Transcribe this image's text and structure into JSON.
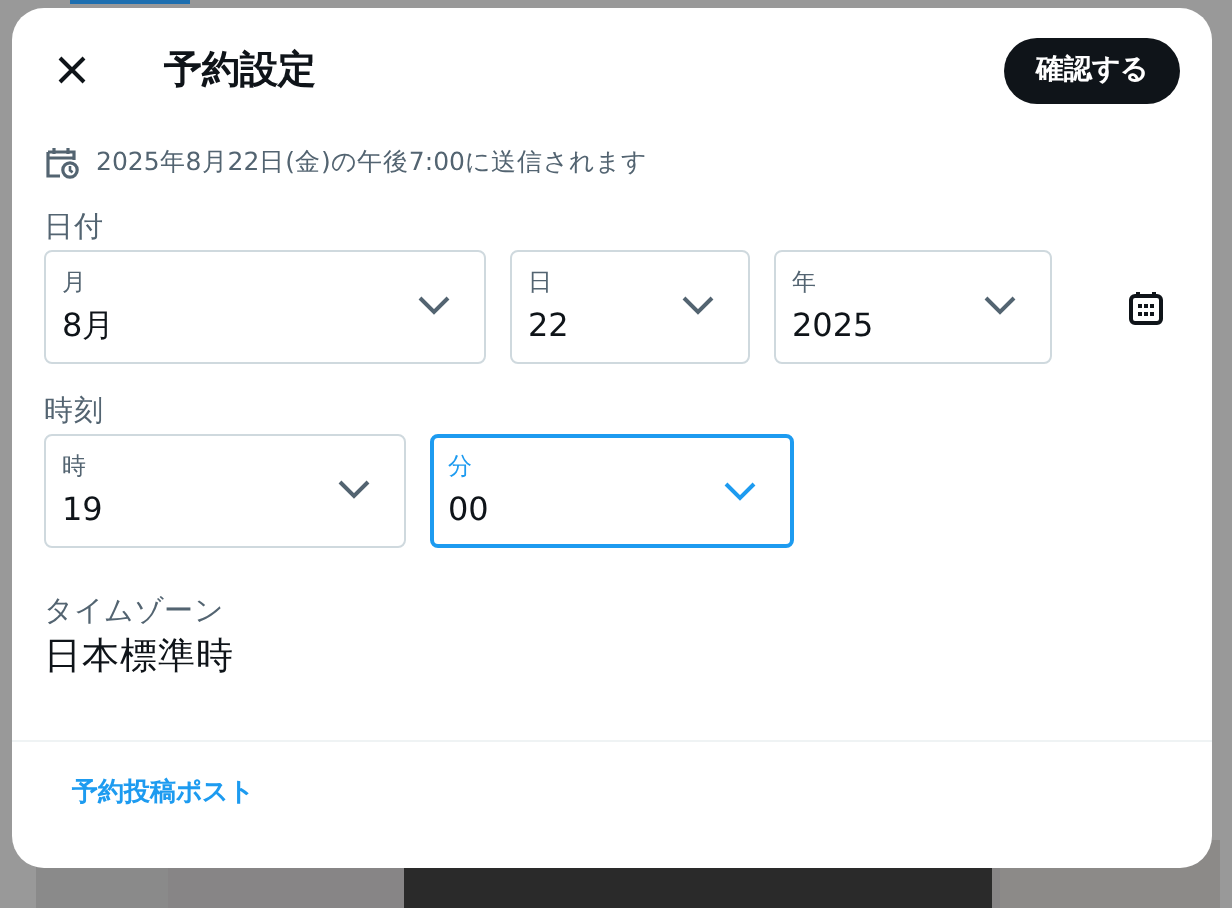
{
  "dialog": {
    "title": "予約設定",
    "confirm_button": "確認する",
    "schedule_note": "2025年8月22日(金)の午後7:00に送信されます"
  },
  "date": {
    "label": "日付",
    "fields": [
      {
        "label": "月",
        "value": "8月",
        "focused": false
      },
      {
        "label": "日",
        "value": "22",
        "focused": false
      },
      {
        "label": "年",
        "value": "2025",
        "focused": false
      }
    ]
  },
  "time": {
    "label": "時刻",
    "fields": [
      {
        "label": "時",
        "value": "19",
        "focused": false
      },
      {
        "label": "分",
        "value": "00",
        "focused": true
      }
    ]
  },
  "timezone": {
    "label": "タイムゾーン",
    "value": "日本標準時"
  },
  "footer_link": "予約投稿ポスト"
}
